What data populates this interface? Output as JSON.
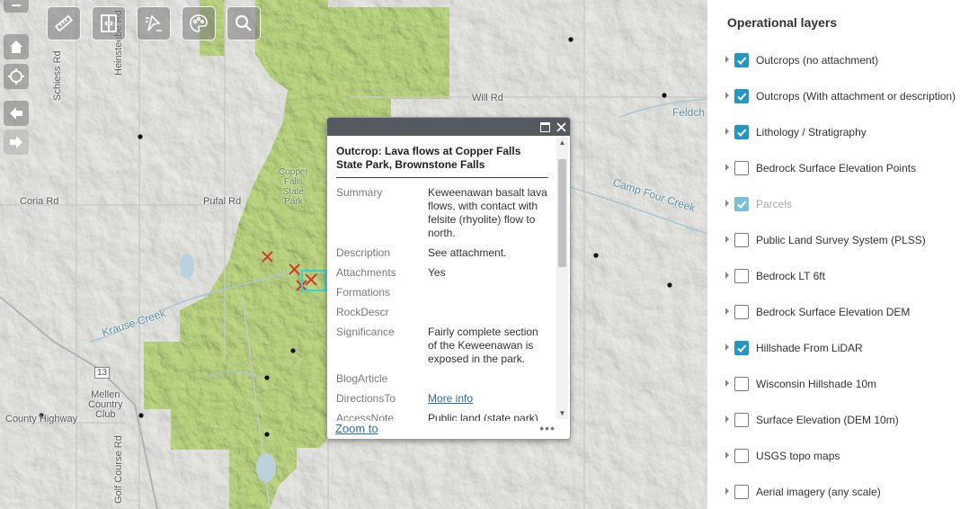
{
  "map": {
    "labels": {
      "schiess_rd": "Schiess Rd",
      "neuberger_rd": "Heinsteebe Rd",
      "pufal_rd": "Pufal Rd",
      "coria_rd": "Coria Rd",
      "krause_creek": "Krause Creek",
      "will_rd": "Will Rd",
      "feldcher": "Feldch",
      "camp_four_creek": "Camp Four Creek",
      "mellen_cc": "Mellen\nCountry\nClub",
      "county_highway": "County Highway",
      "golf_course_rd": "Golf Course Rd",
      "hwy_13": "13",
      "copper_falls": "Copper\nFalls\nState\nPark"
    },
    "colors": {
      "park": "#b6d47a",
      "hillshade": "#e4e5e1",
      "water": "#b9d2db",
      "marker": "#d23a2e",
      "selection": "#38d0d4"
    }
  },
  "toolbar": {
    "buttons": [
      "ruler-icon",
      "swipe-icon",
      "select-icon",
      "basemap-palette-icon",
      "search-icon"
    ]
  },
  "nav": {
    "buttons": [
      "zoom-out-icon",
      "home-icon",
      "locate-icon",
      "back-icon",
      "forward-icon"
    ]
  },
  "popup": {
    "title": "Outcrop: Lava flows at Copper Falls State Park, Brownstone Falls",
    "fields": [
      {
        "key": "Summary",
        "value": "Keweenawan basalt lava flows, with contact with felsite (rhyolite) flow to north."
      },
      {
        "key": "Description",
        "value": "See attachment."
      },
      {
        "key": "Attachments",
        "value": "Yes"
      },
      {
        "key": "Formations",
        "value": ""
      },
      {
        "key": "RockDescr",
        "value": ""
      },
      {
        "key": "Significance",
        "value": "Fairly complete section of the Keweenawan is exposed in the park."
      },
      {
        "key": "BlogArticle",
        "value": ""
      },
      {
        "key": "DirectionsTo",
        "value": "More info"
      },
      {
        "key": "AccessNote",
        "value": "Public land (state park)"
      }
    ],
    "zoom_label": "Zoom to",
    "more_label": "•••"
  },
  "panel": {
    "title": "Operational layers",
    "layers": [
      {
        "label": "Outcrops (no attachment)",
        "checked": true,
        "dim": false
      },
      {
        "label": "Outcrops (With attachment or description)",
        "checked": true,
        "dim": false
      },
      {
        "label": "Lithology / Stratigraphy",
        "checked": true,
        "dim": false
      },
      {
        "label": "Bedrock Surface Elevation Points",
        "checked": false,
        "dim": false
      },
      {
        "label": "Parcels",
        "checked": true,
        "dim": true
      },
      {
        "label": "Public Land Survey System (PLSS)",
        "checked": false,
        "dim": false
      },
      {
        "label": "Bedrock LT 6ft",
        "checked": false,
        "dim": false
      },
      {
        "label": "Bedrock Surface Elevation DEM",
        "checked": false,
        "dim": false
      },
      {
        "label": "Hillshade From LiDAR",
        "checked": true,
        "dim": false
      },
      {
        "label": "Wisconsin Hillshade 10m",
        "checked": false,
        "dim": false
      },
      {
        "label": "Surface Elevation (DEM 10m)",
        "checked": false,
        "dim": false
      },
      {
        "label": "USGS topo maps",
        "checked": false,
        "dim": false
      },
      {
        "label": "Aerial imagery (any scale)",
        "checked": false,
        "dim": false
      }
    ]
  }
}
